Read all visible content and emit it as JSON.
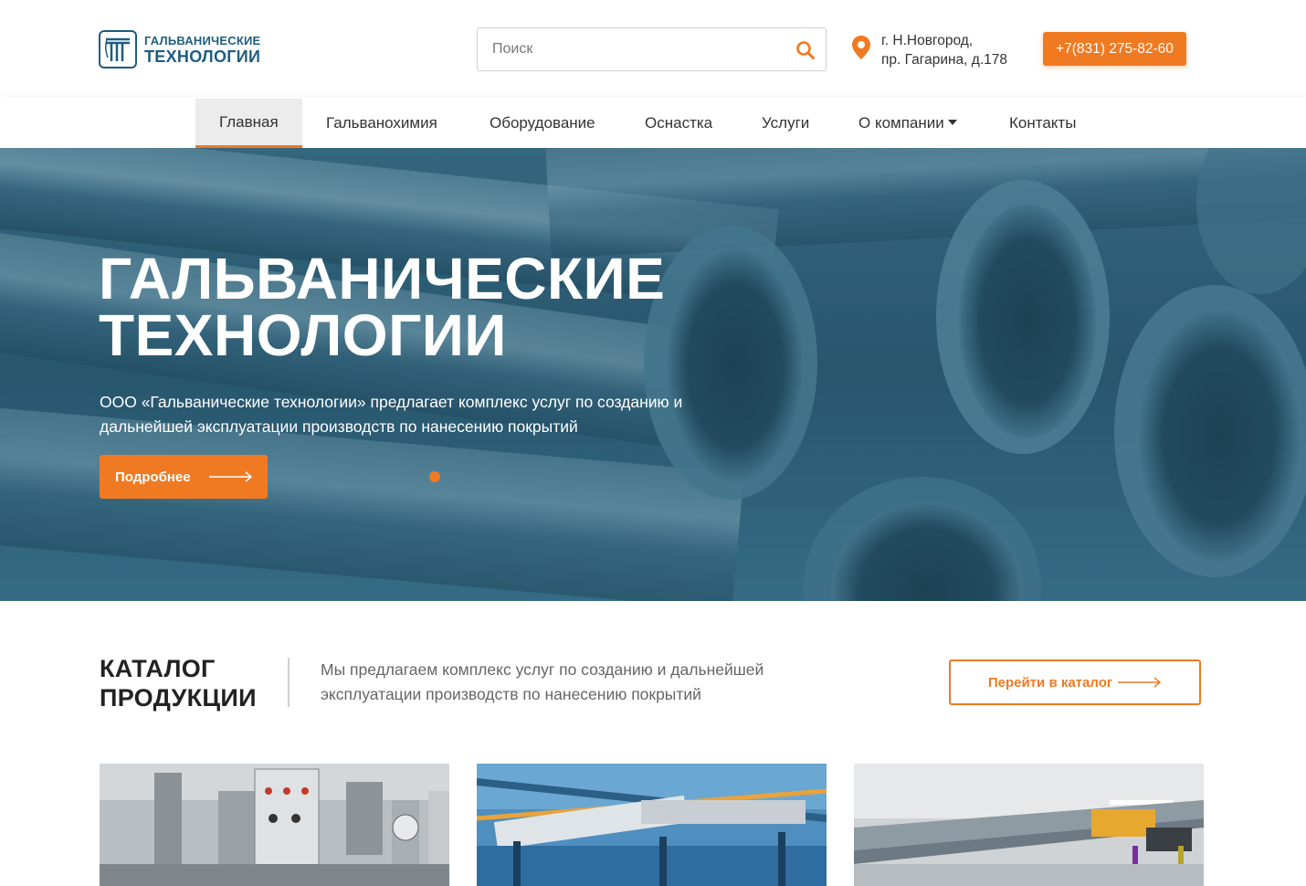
{
  "header": {
    "logo_line1": "ГАЛЬВАНИЧЕСКИЕ",
    "logo_line2": "ТЕХНОЛОГИИ",
    "search_placeholder": "Поиск",
    "address_line1": "г. Н.Новгород,",
    "address_line2": "пр. Гагарина, д.178",
    "phone": "+7(831) 275-82-60",
    "icons": [
      "logo-icon",
      "search-icon",
      "location-pin-icon"
    ]
  },
  "nav": {
    "items": [
      {
        "label": "Главная",
        "active": true
      },
      {
        "label": "Гальванохимия"
      },
      {
        "label": "Оборудование"
      },
      {
        "label": "Оснастка"
      },
      {
        "label": "Услуги"
      },
      {
        "label": "О компании",
        "has_dropdown": true
      },
      {
        "label": "Контакты"
      }
    ]
  },
  "hero": {
    "title_line1": "ГАЛЬВАНИЧЕСКИЕ",
    "title_line2": "ТЕХНОЛОГИИ",
    "description_line1": "ООО «Гальванические технологии» предлагает комплекс услуг по созданию и",
    "description_line2": "дальнейшей эксплуатации производств по нанесению покрытий",
    "button_label": "Подробнее"
  },
  "catalog": {
    "title_line1": "КАТАЛОГ",
    "title_line2": "ПРОДУКЦИИ",
    "description_line1": "Мы предлагаем комплекс услуг по созданию и дальнейшей",
    "description_line2": "эксплуатации производств по нанесению покрытий",
    "button_label": "Перейти в каталог"
  },
  "colors": {
    "accent": "#f07a22",
    "brand": "#1e5d80",
    "hero_tint": "#2b5c72"
  }
}
